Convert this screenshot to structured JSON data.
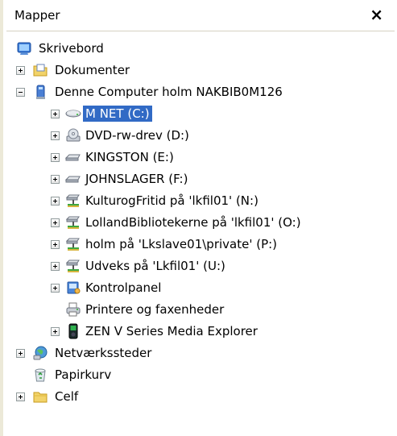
{
  "header": {
    "title": "Mapper",
    "close": "×"
  },
  "items": [
    {
      "label": "Skrivebord",
      "icon": "desktop-icon"
    },
    {
      "label": "Dokumenter",
      "icon": "folder-documents-icon"
    },
    {
      "label": "Denne Computer holm NAKBIB0M126",
      "icon": "computer-icon"
    },
    {
      "label": "M NET (C:)",
      "icon": "hard-drive-icon",
      "selected": true
    },
    {
      "label": "DVD-rw-drev (D:)",
      "icon": "dvd-drive-icon"
    },
    {
      "label": "KINGSTON (E:)",
      "icon": "removable-drive-icon"
    },
    {
      "label": "JOHNSLAGER (F:)",
      "icon": "removable-drive-icon"
    },
    {
      "label": "KulturogFritid på 'lkfil01' (N:)",
      "icon": "network-drive-icon"
    },
    {
      "label": "LollandBibliotekerne på 'lkfil01' (O:)",
      "icon": "network-drive-icon"
    },
    {
      "label": "holm på 'Lkslave01\\private' (P:)",
      "icon": "network-drive-icon"
    },
    {
      "label": "Udveks på 'Lkfil01' (U:)",
      "icon": "network-drive-icon"
    },
    {
      "label": "Kontrolpanel",
      "icon": "control-panel-icon"
    },
    {
      "label": "Printere og faxenheder",
      "icon": "printer-icon"
    },
    {
      "label": "ZEN V Series Media Explorer",
      "icon": "media-player-icon"
    },
    {
      "label": "Netværkssteder",
      "icon": "network-places-icon"
    },
    {
      "label": "Papirkurv",
      "icon": "recycle-bin-icon"
    },
    {
      "label": "Celf",
      "icon": "folder-icon"
    }
  ]
}
